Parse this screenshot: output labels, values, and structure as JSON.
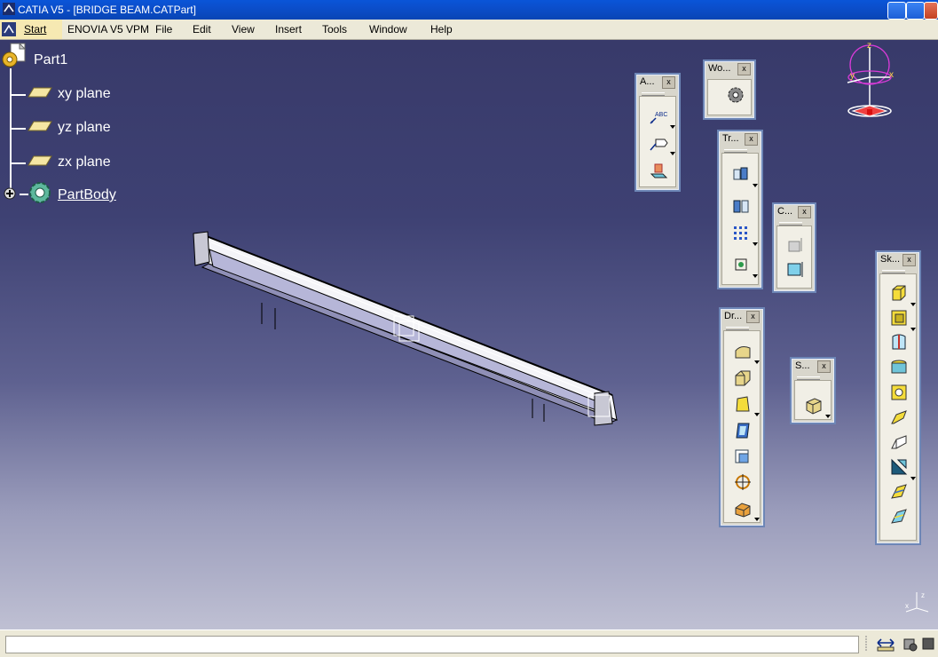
{
  "window": {
    "title": "CATIA V5 - [BRIDGE BEAM.CATPart]"
  },
  "menubar": {
    "start": "Start",
    "items": [
      "ENOVIA V5 VPM",
      "File",
      "Edit",
      "View",
      "Insert",
      "Tools",
      "Window",
      "Help"
    ]
  },
  "tree": {
    "root": "Part1",
    "nodes": [
      "xy plane",
      "yz plane",
      "zx plane",
      "PartBody"
    ]
  },
  "toolbars": {
    "annotations": {
      "title": "A...",
      "close": "x"
    },
    "workbench": {
      "title": "Wo...",
      "close": "x"
    },
    "transformations": {
      "title": "Tr...",
      "close": "x"
    },
    "constraints": {
      "title": "C...",
      "close": "x"
    },
    "dress_up": {
      "title": "Dr...",
      "close": "x"
    },
    "surface": {
      "title": "S...",
      "close": "x"
    },
    "sketch_based": {
      "title": "Sk...",
      "close": "x"
    }
  },
  "compass": {
    "z": "z",
    "x": "x",
    "y": "y"
  },
  "colors": {
    "title_blue": "#0a55d8",
    "menu_bg": "#ece9d8",
    "viewport_top": "#383a6a",
    "viewport_bottom": "#bfc0d3"
  },
  "icons": [
    "catia-logo-icon",
    "plane-icon",
    "partbody-gear-icon",
    "expand-plus-icon",
    "text-abc-icon",
    "flag-note-icon",
    "annotation-plane-icon",
    "workbench-gear-icon",
    "translate-icon",
    "mirror-icon",
    "pattern-icon",
    "scale-icon",
    "constraint-icon",
    "constraint-box-icon",
    "fillet-icon",
    "chamfer-icon",
    "draft-icon",
    "shell-icon",
    "thickness-icon",
    "thread-icon",
    "remove-face-icon",
    "surface-split-icon",
    "pad-icon",
    "pocket-icon",
    "shaft-icon",
    "groove-icon",
    "hole-icon",
    "rib-icon",
    "slot-icon",
    "stiffener-icon",
    "loft-icon",
    "remove-loft-icon",
    "measure-icon",
    "cache-icon",
    "power-input-icon"
  ]
}
